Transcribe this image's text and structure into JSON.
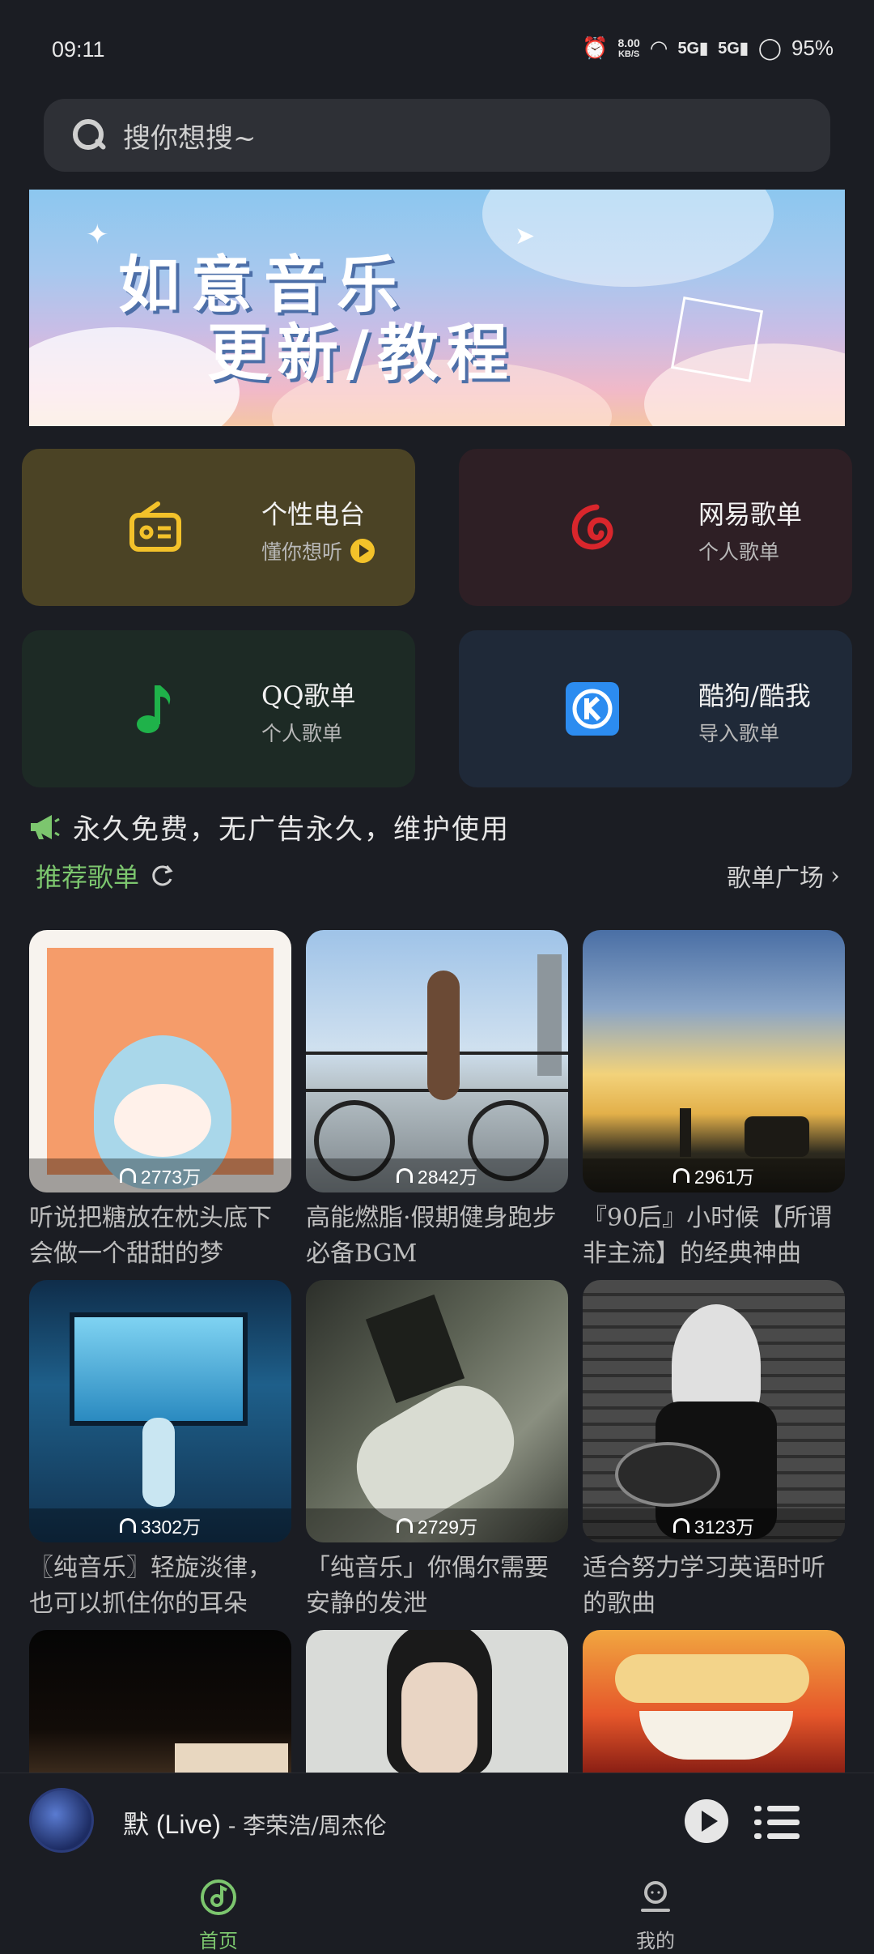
{
  "status_bar": {
    "time": "09:11",
    "net_speed_top": "8.00",
    "net_speed_unit": "KB/S",
    "signal_1": "5G",
    "signal_2": "5G",
    "battery": "95%"
  },
  "search": {
    "placeholder": "搜你想搜~"
  },
  "banner": {
    "line1": "如意音乐",
    "line2": "更新/教程"
  },
  "quick_cards": [
    {
      "title": "个性电台",
      "subtitle": "懂你想听",
      "icon": "radio-icon",
      "bg": "#4b4325",
      "accent": "#f3c22a"
    },
    {
      "title": "网易歌单",
      "subtitle": "个人歌单",
      "icon": "netease-icon",
      "bg": "#2e1f25",
      "accent": "#d9262c"
    },
    {
      "title": "QQ歌单",
      "subtitle": "个人歌单",
      "icon": "music-note-icon",
      "bg": "#1d2a25",
      "accent": "#1fb24a"
    },
    {
      "title": "酷狗/酷我",
      "subtitle": "导入歌单",
      "icon": "kugou-icon",
      "bg": "#1f2938",
      "accent": "#2c8cf0"
    }
  ],
  "notice": {
    "text": "永久免费，无广告永久，维护使用",
    "icon": "megaphone-icon"
  },
  "section": {
    "title": "推荐歌单",
    "more": "歌单广场"
  },
  "playlists": [
    {
      "count": "2773万",
      "title": "听说把糖放在枕头底下会做一个甜甜的梦"
    },
    {
      "count": "2842万",
      "title": "高能燃脂·假期健身跑步必备BGM"
    },
    {
      "count": "2961万",
      "title": "『90后』小时候【所谓非主流】的经典神曲"
    },
    {
      "count": "3302万",
      "title": "〖纯音乐〗轻旋淡律，也可以抓住你的耳朵"
    },
    {
      "count": "2729万",
      "title": "「纯音乐」你偶尔需要安静的发泄"
    },
    {
      "count": "3123万",
      "title": "适合努力学习英语时听的歌曲"
    }
  ],
  "player": {
    "title": "默 (Live)",
    "separator": " - ",
    "artist": "李荣浩/周杰伦"
  },
  "tabs": [
    {
      "label": "首页",
      "active": true,
      "color": "#7cc66e"
    },
    {
      "label": "我的",
      "active": false,
      "color": "#bdbdbd"
    }
  ]
}
